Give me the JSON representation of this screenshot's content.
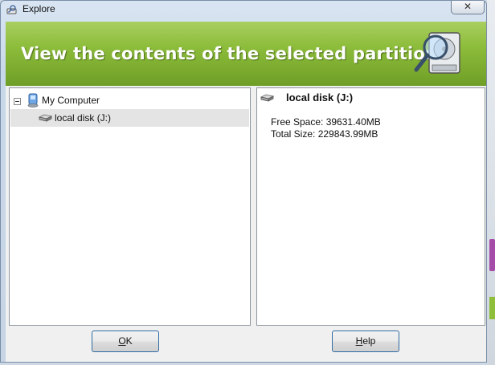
{
  "window": {
    "title": "Explore",
    "close_glyph": "✕"
  },
  "banner": {
    "text": "View the contents of the selected partition",
    "icon": "hard-disk-magnifier-icon"
  },
  "tree": {
    "root": {
      "label": "My Computer",
      "icon": "computer-icon",
      "expanded": true
    },
    "children": [
      {
        "label": "local disk (J:)",
        "icon": "drive-icon",
        "selected": true
      }
    ]
  },
  "details": {
    "title": "local disk (J:)",
    "free_space": "Free Space: 39631.40MB",
    "total_size": "Total Size: 229843.99MB"
  },
  "buttons": {
    "ok": {
      "mnemonic": "O",
      "rest": "K"
    },
    "help": {
      "mnemonic": "H",
      "rest": "elp"
    }
  },
  "colors": {
    "banner_green": "#8cbc3a",
    "accent_border": "#2f6aa3"
  }
}
